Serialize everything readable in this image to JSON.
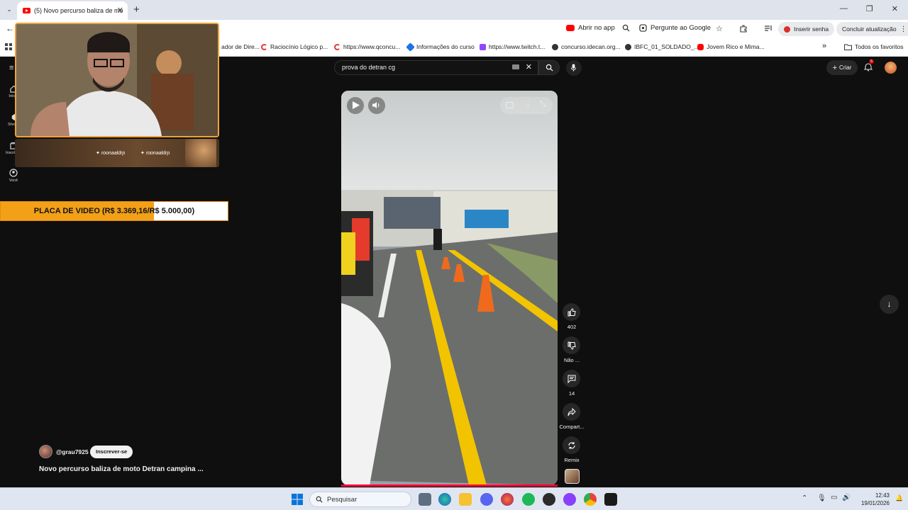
{
  "browser": {
    "tab_title": "(5) Novo percurso baliza de mo",
    "toolbar": {
      "open_app": "Abrir no app",
      "ask_google": "Pergunte ao Google",
      "insert_password": "Inserir senha",
      "finish_update": "Concluir atualização"
    },
    "bookmarks": [
      {
        "label": "ador de Dire...",
        "icon": "folder-icon"
      },
      {
        "label": "Raciocínio Lógico p...",
        "icon": "qconcursos-icon"
      },
      {
        "label": "https://www.qconcu...",
        "icon": "qconcursos-icon"
      },
      {
        "label": "Informações do curso",
        "icon": "course-icon"
      },
      {
        "label": "https://www.twitch.t...",
        "icon": "twitch-icon"
      },
      {
        "label": "concurso.idecan.org...",
        "icon": "globe-icon"
      },
      {
        "label": "IBFC_01_SOLDADO_...",
        "icon": "globe-icon"
      },
      {
        "label": "Jovem Rico e Mima...",
        "icon": "youtube-icon"
      }
    ],
    "all_favorites": "Todos os favoritos"
  },
  "youtube": {
    "search_value": "prova do detran cg",
    "create_label": "Criar",
    "notifications_count": "5",
    "left_nav": [
      "Início",
      "Shorts",
      "Inscrições",
      "Você"
    ],
    "actions": {
      "likes": "402",
      "dislike_label": "Não ...",
      "comments": "14",
      "share_label": "Compart...",
      "remix_label": "Remix"
    },
    "channel": "@grau7925",
    "subscribe_label": "Inscrever-se",
    "video_title": "Novo percurso baliza de moto Detran campina ..."
  },
  "overlays": {
    "handle_1": "roonaaldrp",
    "handle_2": "roonaaldrp",
    "goal_label": "PLACA DE VIDEO (R$ 3.369,16/R$ 5.000,00)",
    "goal_progress": 0.674
  },
  "taskbar": {
    "search_placeholder": "Pesquisar",
    "time": "12:43",
    "date": "19/01/2026"
  },
  "colors": {
    "youtube_red": "#ff0000",
    "goal_fill": "#f2a017",
    "goal_border": "#e98a12",
    "cam_border": "#f0a33a"
  }
}
